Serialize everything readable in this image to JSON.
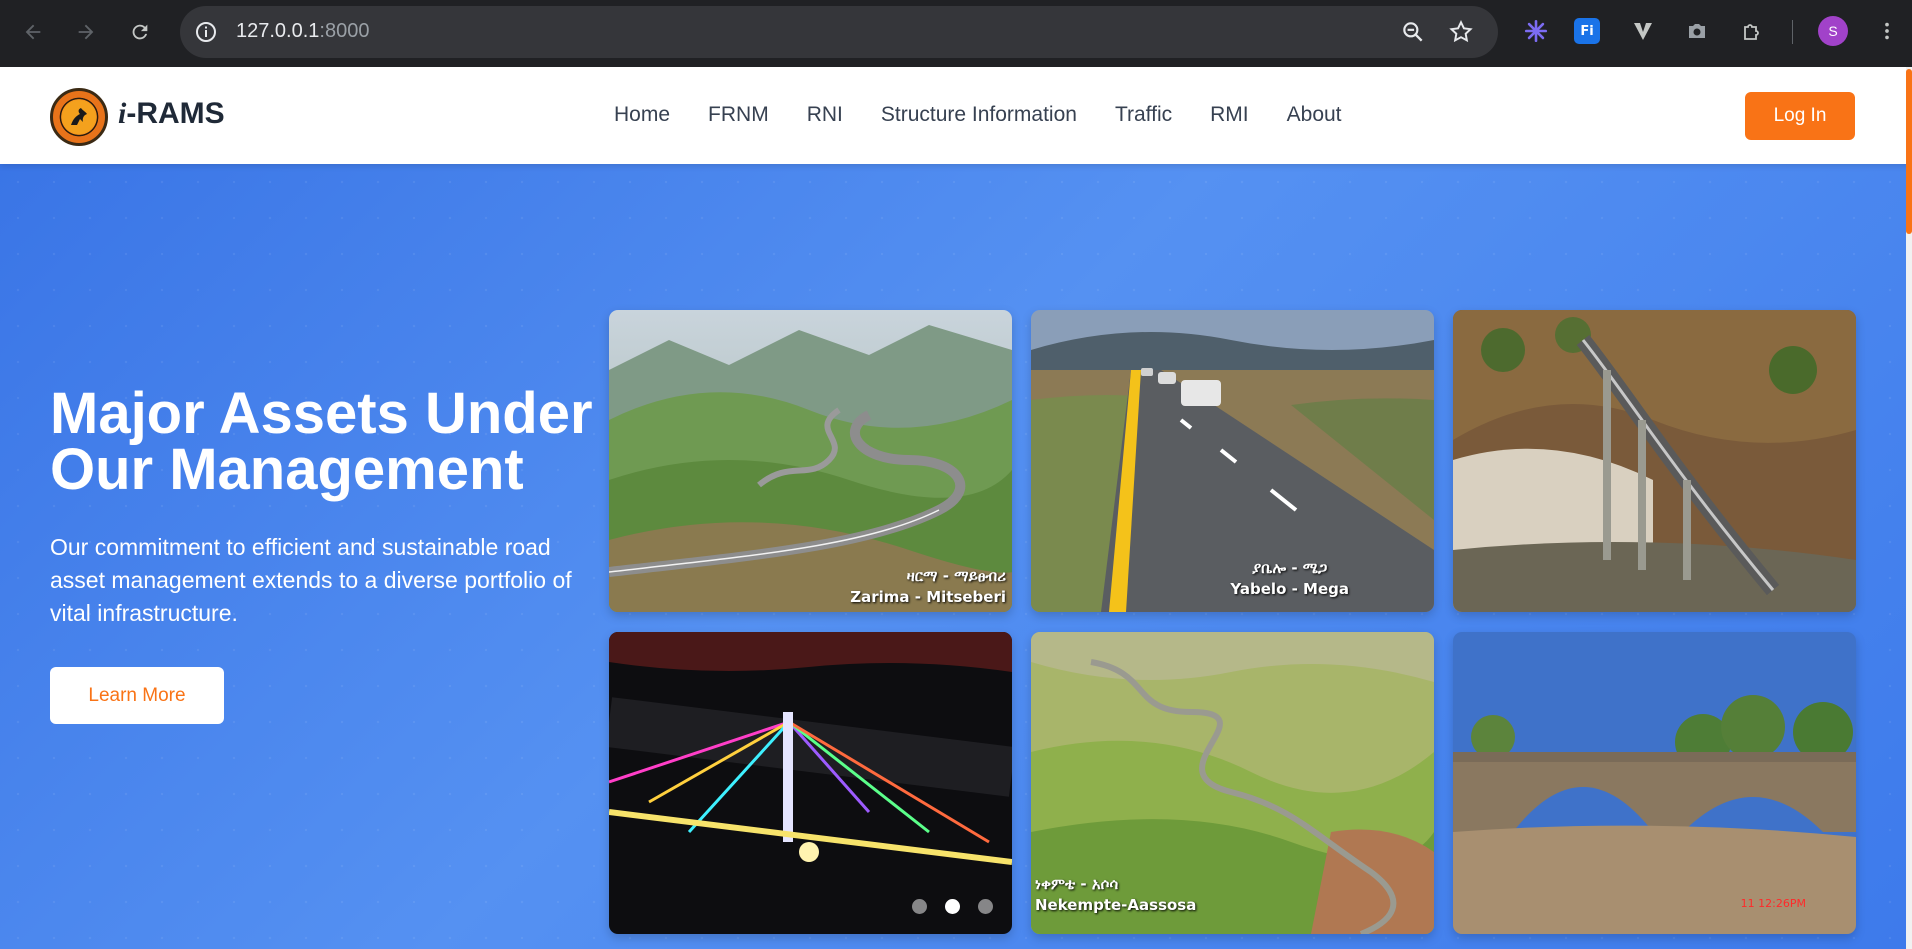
{
  "browser": {
    "url_host": "127.0.0.1",
    "url_port": ":8000",
    "profile_initial": "S",
    "extensions": [
      "spark-icon",
      "fi-extension-icon",
      "v-extension-icon",
      "camera-icon",
      "puzzle-icon"
    ]
  },
  "site": {
    "brand_prefix": "i",
    "brand_suffix": "-RAMS",
    "nav": [
      "Home",
      "FRNM",
      "RNI",
      "Structure Information",
      "Traffic",
      "RMI",
      "About"
    ],
    "login_label": "Log In",
    "accent_color": "#f97316"
  },
  "hero": {
    "title": "Major Assets Under Our Management",
    "description": "Our commitment to efficient and sustainable road asset management extends to a diverse portfolio of vital infrastructure.",
    "cta_label": "Learn More",
    "captions": {
      "tile1_line1": "ዛርማ - ማይፀብሪ",
      "tile1_line2": "Zarima - Mitseberi",
      "tile2_line1": "ያቤሎ - ሜጋ",
      "tile2_line2": "Yabelo - Mega",
      "tile5_line1": "ነቀምቴ - አሶሳ",
      "tile5_line2": "Nekempte-Aassosa",
      "tile6_stamp": "11 12:26PM"
    },
    "carousel": {
      "total": 3,
      "active": 2
    }
  }
}
